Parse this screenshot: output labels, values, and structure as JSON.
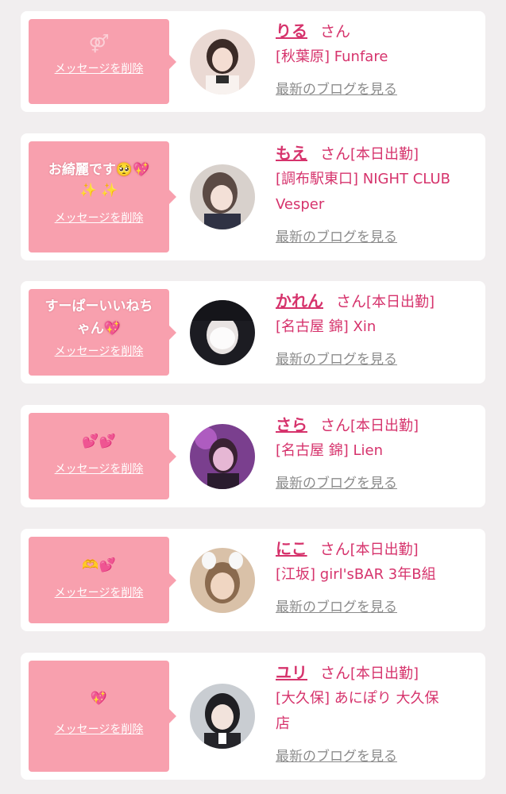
{
  "colors": {
    "bubble": "#f8a0ae",
    "name": "#d6336c",
    "link_gray": "#8c8c8c",
    "background": "#f1eeef"
  },
  "delete_label": "メッセージを削除",
  "honorific": "さん",
  "blog_label": "最新のブログを見る",
  "cards": [
    {
      "name": "りる",
      "status": "",
      "shop_lines": [
        "[秋葉原] Funfare"
      ],
      "message_lines": [],
      "icon": "rings-icon"
    },
    {
      "name": "もえ",
      "status": "[本日出勤]",
      "shop_lines": [
        "[調布駅東口] NIGHT CLUB",
        "Vesper"
      ],
      "message_lines": [
        "お綺麗です🥺💖",
        "✨ ✨"
      ]
    },
    {
      "name": "かれん",
      "status": "[本日出勤]",
      "shop_lines": [
        "[名古屋 錦] Xin"
      ],
      "message_lines": [
        "すーぱーいいねち",
        "ゃん💖"
      ]
    },
    {
      "name": "さら",
      "status": "[本日出勤]",
      "shop_lines": [
        "[名古屋 錦] Lien"
      ],
      "message_lines": [
        "💕💕"
      ]
    },
    {
      "name": "にこ",
      "status": "[本日出勤]",
      "shop_lines": [
        "[江坂] girl'sBAR 3年B組"
      ],
      "message_lines": [
        "🫶💕"
      ]
    },
    {
      "name": "ユリ",
      "status": "[本日出勤]",
      "shop_lines": [
        "[大久保] あにぽり 大久保",
        "店"
      ],
      "message_lines": [
        "💖"
      ]
    }
  ]
}
